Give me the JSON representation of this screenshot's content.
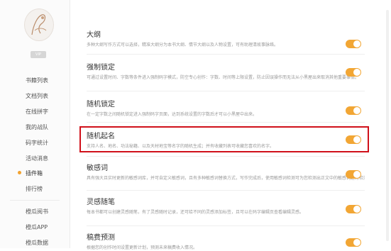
{
  "sidebar": {
    "vip_badge": "VIP",
    "items": [
      {
        "label": "书籍列表"
      },
      {
        "label": "文档列表"
      },
      {
        "label": "在线拼字"
      },
      {
        "label": "我的战队"
      },
      {
        "label": "码字统计"
      },
      {
        "label": "活动消息"
      },
      {
        "label": "插件箱"
      },
      {
        "label": "排行榜"
      }
    ],
    "bottom_items": [
      {
        "label": "橙瓜阅书"
      },
      {
        "label": "橙瓜APP"
      },
      {
        "label": "橙瓜数据"
      }
    ],
    "active_index": 6,
    "active_dot_color": "#f2a22f"
  },
  "settings": [
    {
      "title": "大纲",
      "desc": "多种大纲写作方式可以选择，精准大纲分为本书大纲、情节大纲以及人物设置，可有助理清故事脉络。",
      "enabled": true
    },
    {
      "title": "强制锁定",
      "desc": "可通过设置时间、字数等条件进入强制码字模式，防空专心创作：字数、时间等上限设置，防止因误操作而无法从小黑屋出来取消其他重要事情。",
      "enabled": true
    },
    {
      "title": "随机锁定",
      "desc": "在一定字数之间随机锁定进入强制码字页面，达到系统设置的字数后才可以小黑屋中出来。",
      "enabled": true
    },
    {
      "title": "随机起名",
      "desc": "支持人名、地名、功法秘籍、以及天材地宝等名字的随机生成；并有收藏列表可收藏您喜欢的名字。",
      "enabled": true
    },
    {
      "title": "敏感词",
      "desc": "具有强大且实时更新的敏感词库，并可自定义敏感词，且有多种敏感词替换方式，写作完成后，使用敏感词检测可为您检测出正文中的敏感词进行检测并替换，以免作品无法通过审核。",
      "enabled": true
    },
    {
      "title": "灵感随笔",
      "desc": "每本书都可以创建灵感随笔，有了灵感随时记录，还可给不同的灵感添加标签，且可以在码字编辑页查看编辑灵感。",
      "enabled": true
    },
    {
      "title": "稿费预测",
      "desc": "根据您的创作时间设置更新计划，预测未来稿费收入情况。",
      "enabled": true
    }
  ],
  "highlight_index": 3,
  "colors": {
    "toggle_on": "#f2a634",
    "highlight_border": "#d0101a"
  }
}
